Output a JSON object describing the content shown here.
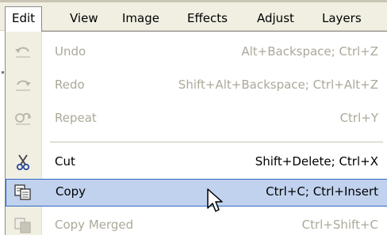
{
  "menubar": {
    "items": [
      "Edit",
      "View",
      "Image",
      "Effects",
      "Adjust",
      "Layers"
    ]
  },
  "menu": {
    "items": [
      {
        "label": "Undo",
        "shortcut": "Alt+Backspace; Ctrl+Z",
        "icon": "undo-icon",
        "enabled": false
      },
      {
        "label": "Redo",
        "shortcut": "Shift+Alt+Backspace; Ctrl+Alt+Z",
        "icon": "redo-icon",
        "enabled": false
      },
      {
        "label": "Repeat",
        "shortcut": "Ctrl+Y",
        "icon": "repeat-icon",
        "enabled": false
      },
      {
        "label": "Cut",
        "shortcut": "Shift+Delete; Ctrl+X",
        "icon": "scissors-icon",
        "enabled": true
      },
      {
        "label": "Copy",
        "shortcut": "Ctrl+C; Ctrl+Insert",
        "icon": "copy-icon",
        "enabled": true,
        "highlighted": true
      },
      {
        "label": "Copy Merged",
        "shortcut": "Ctrl+Shift+C",
        "icon": "copy-merged-icon",
        "enabled": false
      }
    ]
  },
  "colors": {
    "highlight_fill": "#c1d2ee",
    "highlight_border": "#316ac5",
    "disabled_text": "#aca899",
    "menubar_bg": "#f1efe2"
  }
}
